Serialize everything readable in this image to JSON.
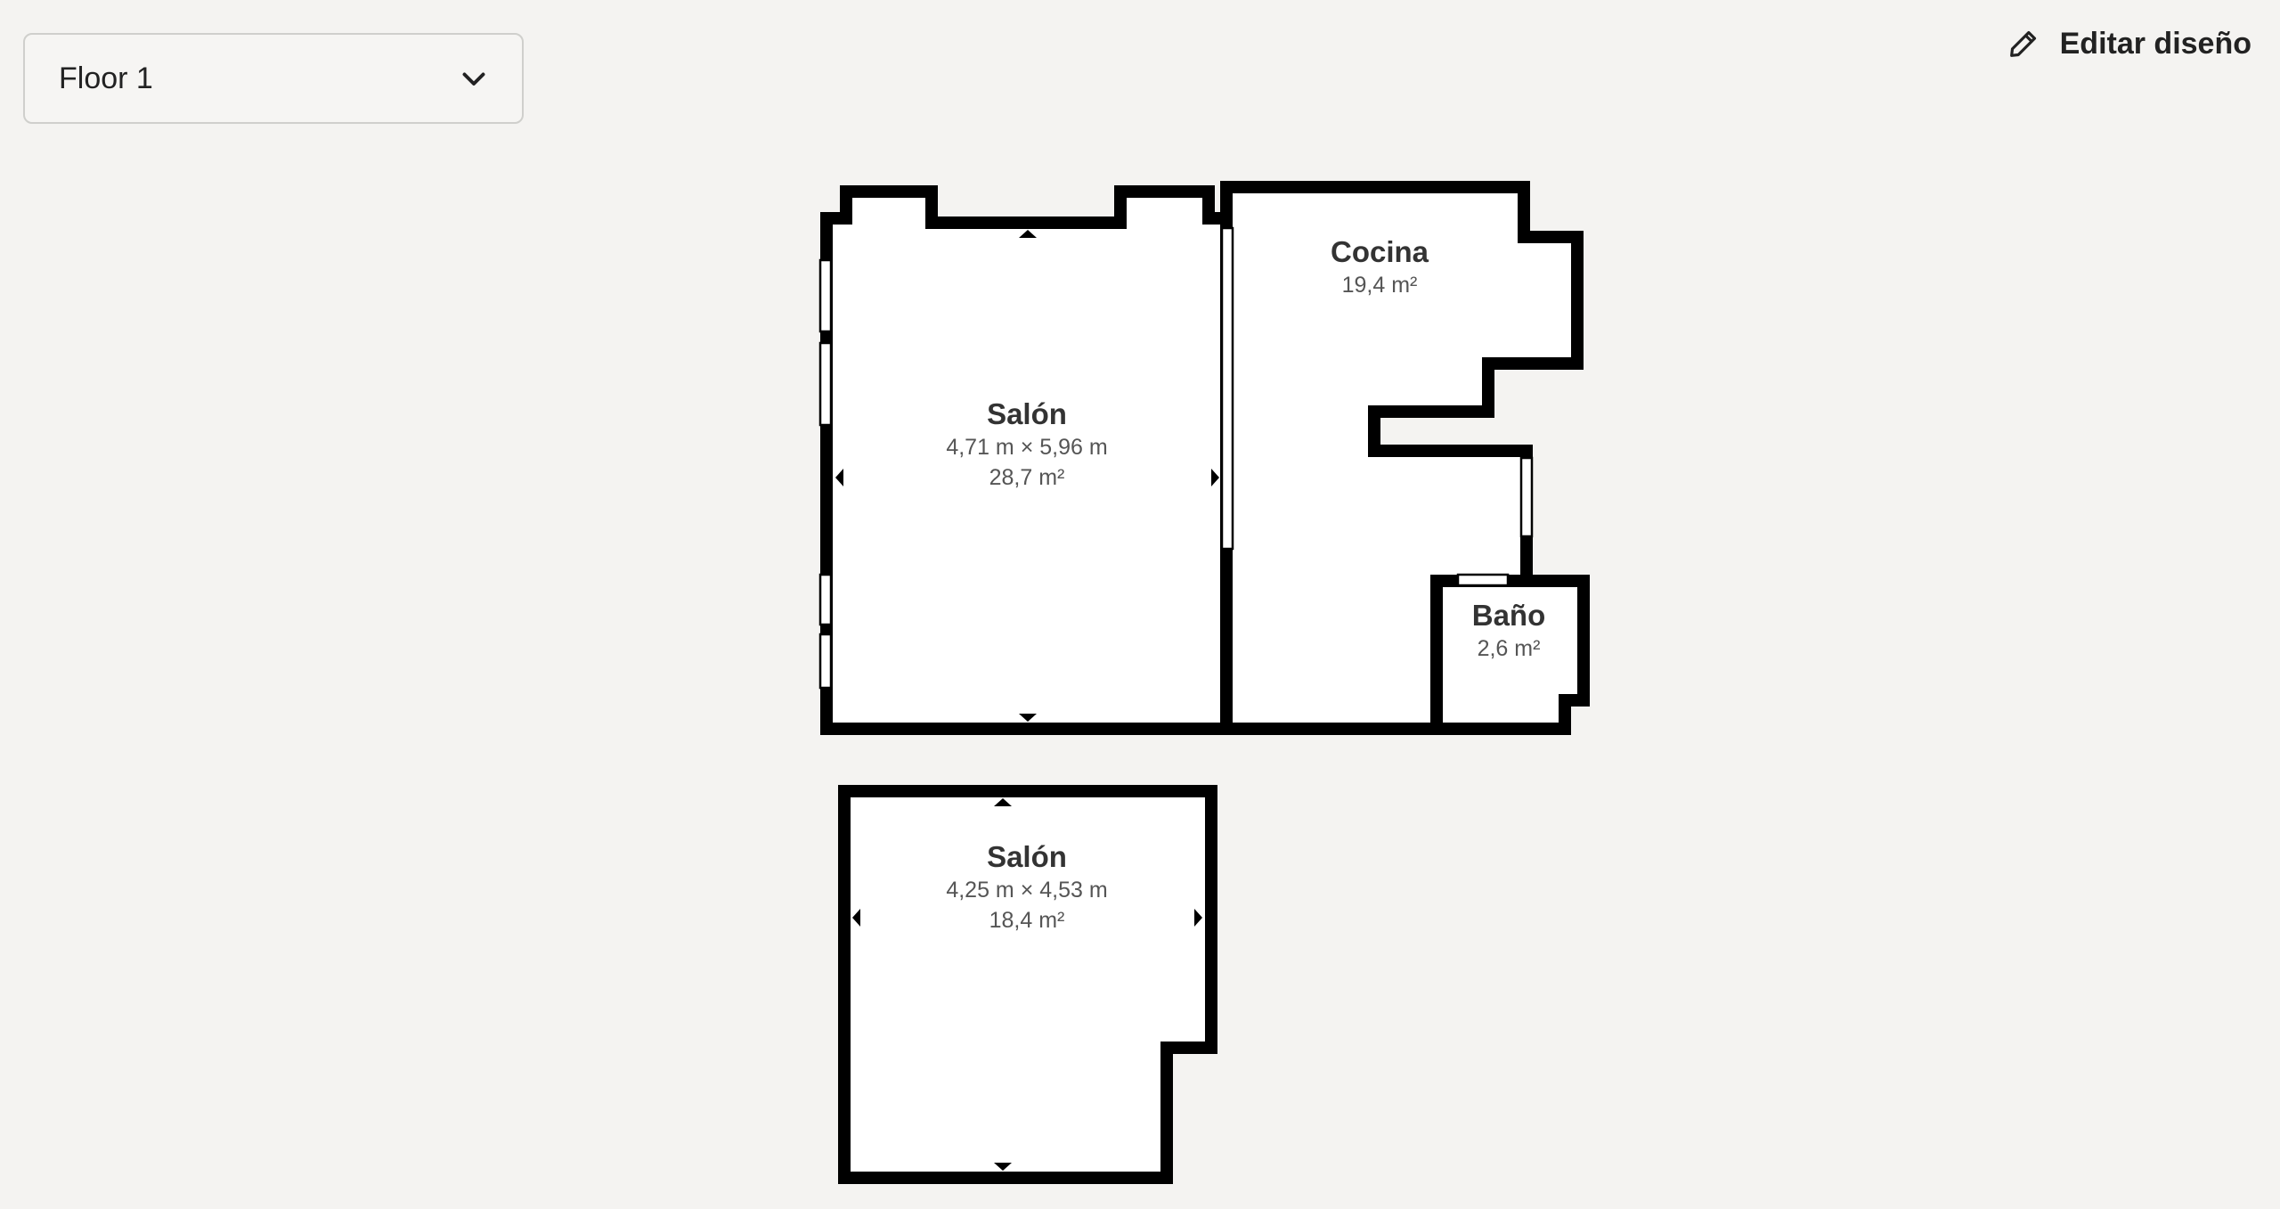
{
  "floor_selector": {
    "value": "Floor 1",
    "icon": "chevron-down-icon"
  },
  "edit_button": {
    "label": "Editar diseño",
    "icon": "pencil-icon"
  },
  "rooms": [
    {
      "name": "Salón",
      "dimensions": "4,71 m × 5,96 m",
      "area": "28,7 m²"
    },
    {
      "name": "Cocina",
      "area": "19,4 m²"
    },
    {
      "name": "Baño",
      "area": "2,6 m²"
    },
    {
      "name": "Salón",
      "dimensions": "4,25 m × 4,53 m",
      "area": "18,4 m²"
    }
  ],
  "colors": {
    "background": "#f4f3f1",
    "walls": "#000000",
    "room_fill": "#ffffff",
    "text": "#222222"
  }
}
